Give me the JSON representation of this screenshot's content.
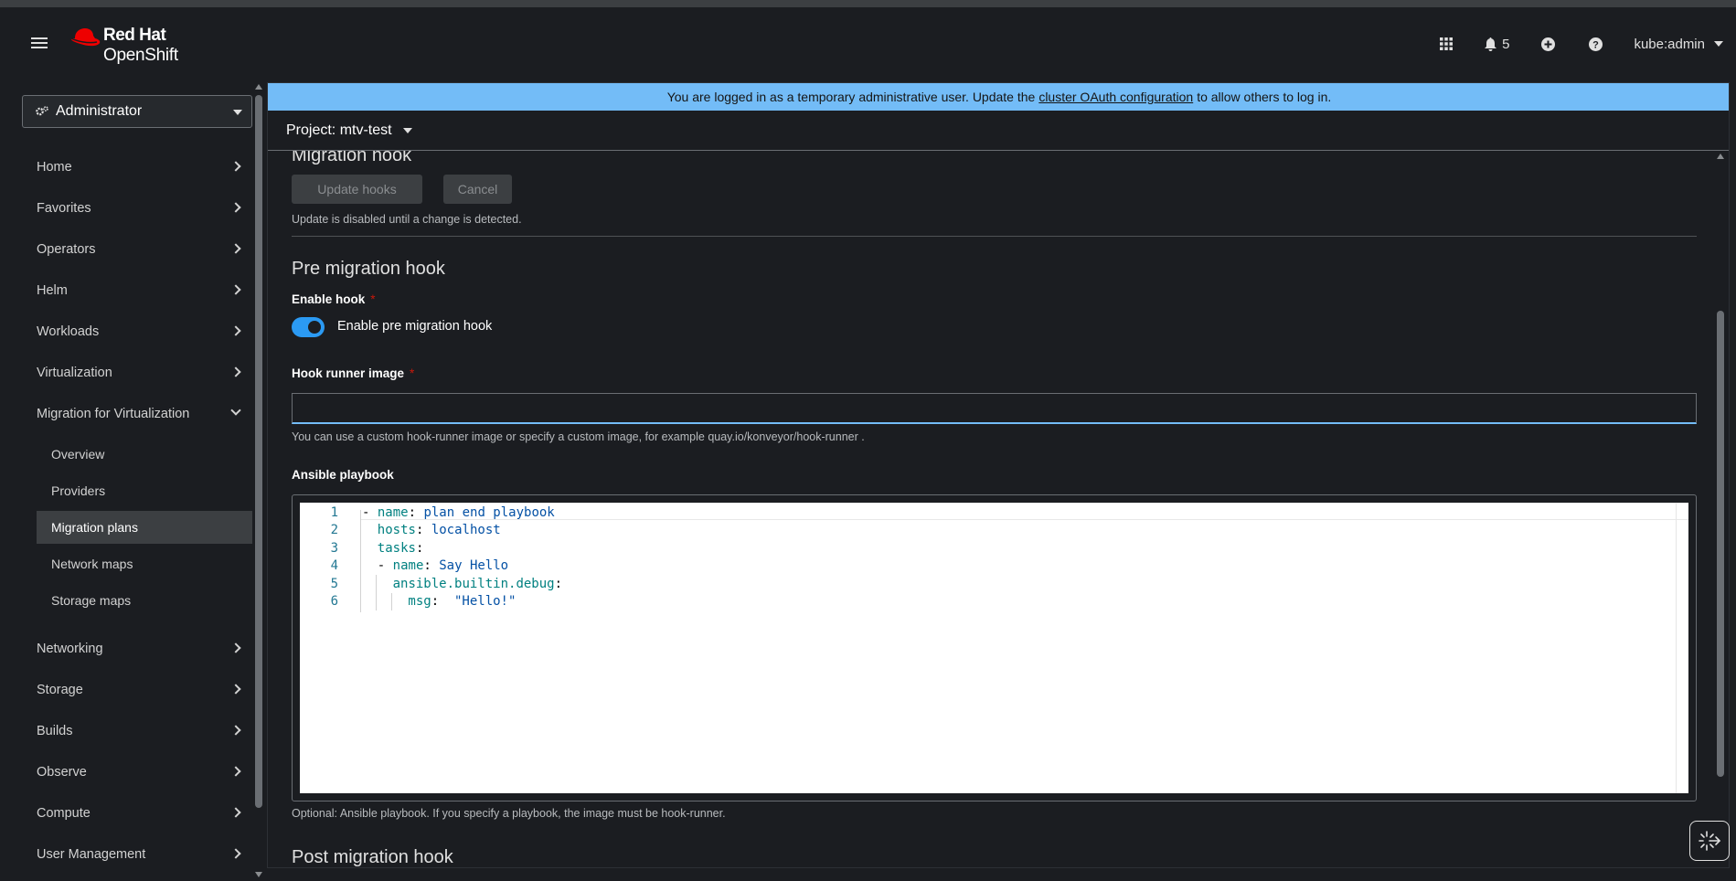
{
  "masthead": {
    "logo_line1": "Red Hat",
    "logo_line2": "OpenShift",
    "notifications_count": "5",
    "user": "kube:admin",
    "icons": [
      "menu-icon",
      "app-launcher-icon",
      "bell-icon",
      "plus-circle-icon",
      "help-icon"
    ]
  },
  "sidebar": {
    "perspective": "Administrator",
    "items": [
      {
        "label": "Home"
      },
      {
        "label": "Favorites"
      },
      {
        "label": "Operators"
      },
      {
        "label": "Helm"
      },
      {
        "label": "Workloads"
      },
      {
        "label": "Virtualization"
      },
      {
        "label": "Migration for Virtualization"
      },
      {
        "label": "Networking"
      },
      {
        "label": "Storage"
      },
      {
        "label": "Builds"
      },
      {
        "label": "Observe"
      },
      {
        "label": "Compute"
      },
      {
        "label": "User Management"
      }
    ],
    "subitems": [
      {
        "label": "Overview"
      },
      {
        "label": "Providers"
      },
      {
        "label": "Migration plans",
        "active": true
      },
      {
        "label": "Network maps"
      },
      {
        "label": "Storage maps"
      }
    ]
  },
  "banner": {
    "before": "You are logged in as a temporary administrative user. Update the",
    "link": "cluster OAuth configuration",
    "after": "to allow others to log in."
  },
  "project": {
    "label": "Project: mtv-test"
  },
  "form": {
    "section_title": "Migration hook",
    "update_button": "Update hooks",
    "cancel_button": "Cancel",
    "update_helper": "Update is disabled until a change is detected.",
    "pre_title": "Pre migration hook",
    "enable_label": "Enable hook",
    "required_mark": "*",
    "toggle_label": "Enable pre migration hook",
    "toggle_on": true,
    "image_label": "Hook runner image",
    "image_value": "",
    "image_helper": "You can use a custom hook-runner image or specify a custom image, for example quay.io/konveyor/hook-runner .",
    "playbook_label": "Ansible playbook",
    "playbook_helper": "Optional: Ansible playbook. If you specify a playbook, the image must be hook-runner.",
    "post_title": "Post migration hook"
  },
  "editor": {
    "lines": [
      {
        "n": "1",
        "dash": "- ",
        "indent": 0,
        "key": "name",
        "val": "plan end playbook"
      },
      {
        "n": "2",
        "dash": "",
        "indent": 1,
        "key": "hosts",
        "val": "localhost"
      },
      {
        "n": "3",
        "dash": "",
        "indent": 1,
        "key": "tasks",
        "val": ""
      },
      {
        "n": "4",
        "dash": "- ",
        "indent": 1,
        "key": "name",
        "val": "Say Hello"
      },
      {
        "n": "5",
        "dash": "",
        "indent": 2,
        "key": "ansible.builtin.debug",
        "val": ""
      },
      {
        "n": "6",
        "dash": "",
        "indent": 3,
        "key": "msg",
        "val": " \"Hello!\""
      }
    ]
  }
}
